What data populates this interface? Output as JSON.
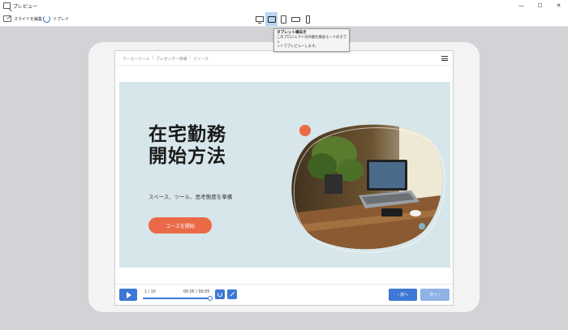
{
  "window": {
    "title": "プレビュー",
    "minimize": "—",
    "maximize": "☐",
    "close": "✕"
  },
  "toolbar": {
    "edit_label": "スライドを編集",
    "replay_label": "リプレイ"
  },
  "device_buttons": [
    "desktop-icon",
    "tablet-landscape-icon",
    "tablet-portrait-icon",
    "phone-landscape-icon",
    "phone-portrait-icon"
  ],
  "active_device": "tablet-landscape",
  "tooltip": {
    "title": "タブレット横向き",
    "line1": "このプロジェクトの外観を横長モードのタブレ",
    "line2": "ットでプレビューします。"
  },
  "breadcrumb": [
    "マーカーツール",
    "プレゼンター情報",
    "リソース"
  ],
  "slide": {
    "title_line1": "在宅勤務",
    "title_line2": "開始方法",
    "subtitle": "スペース、ツール、思考態度を準備",
    "button_label": "コースを開始"
  },
  "player": {
    "counter": "1 / 10",
    "timecode": "00:05 / 00:05",
    "progress": 1.0,
    "prev_label": "‹ 前へ",
    "next_label": "次へ ›"
  },
  "colors": {
    "accent": "#3d78d6",
    "slide_bg": "#d7e6ea",
    "cta": "#ea6a48",
    "tooltip_active": "#b8d6f0"
  }
}
